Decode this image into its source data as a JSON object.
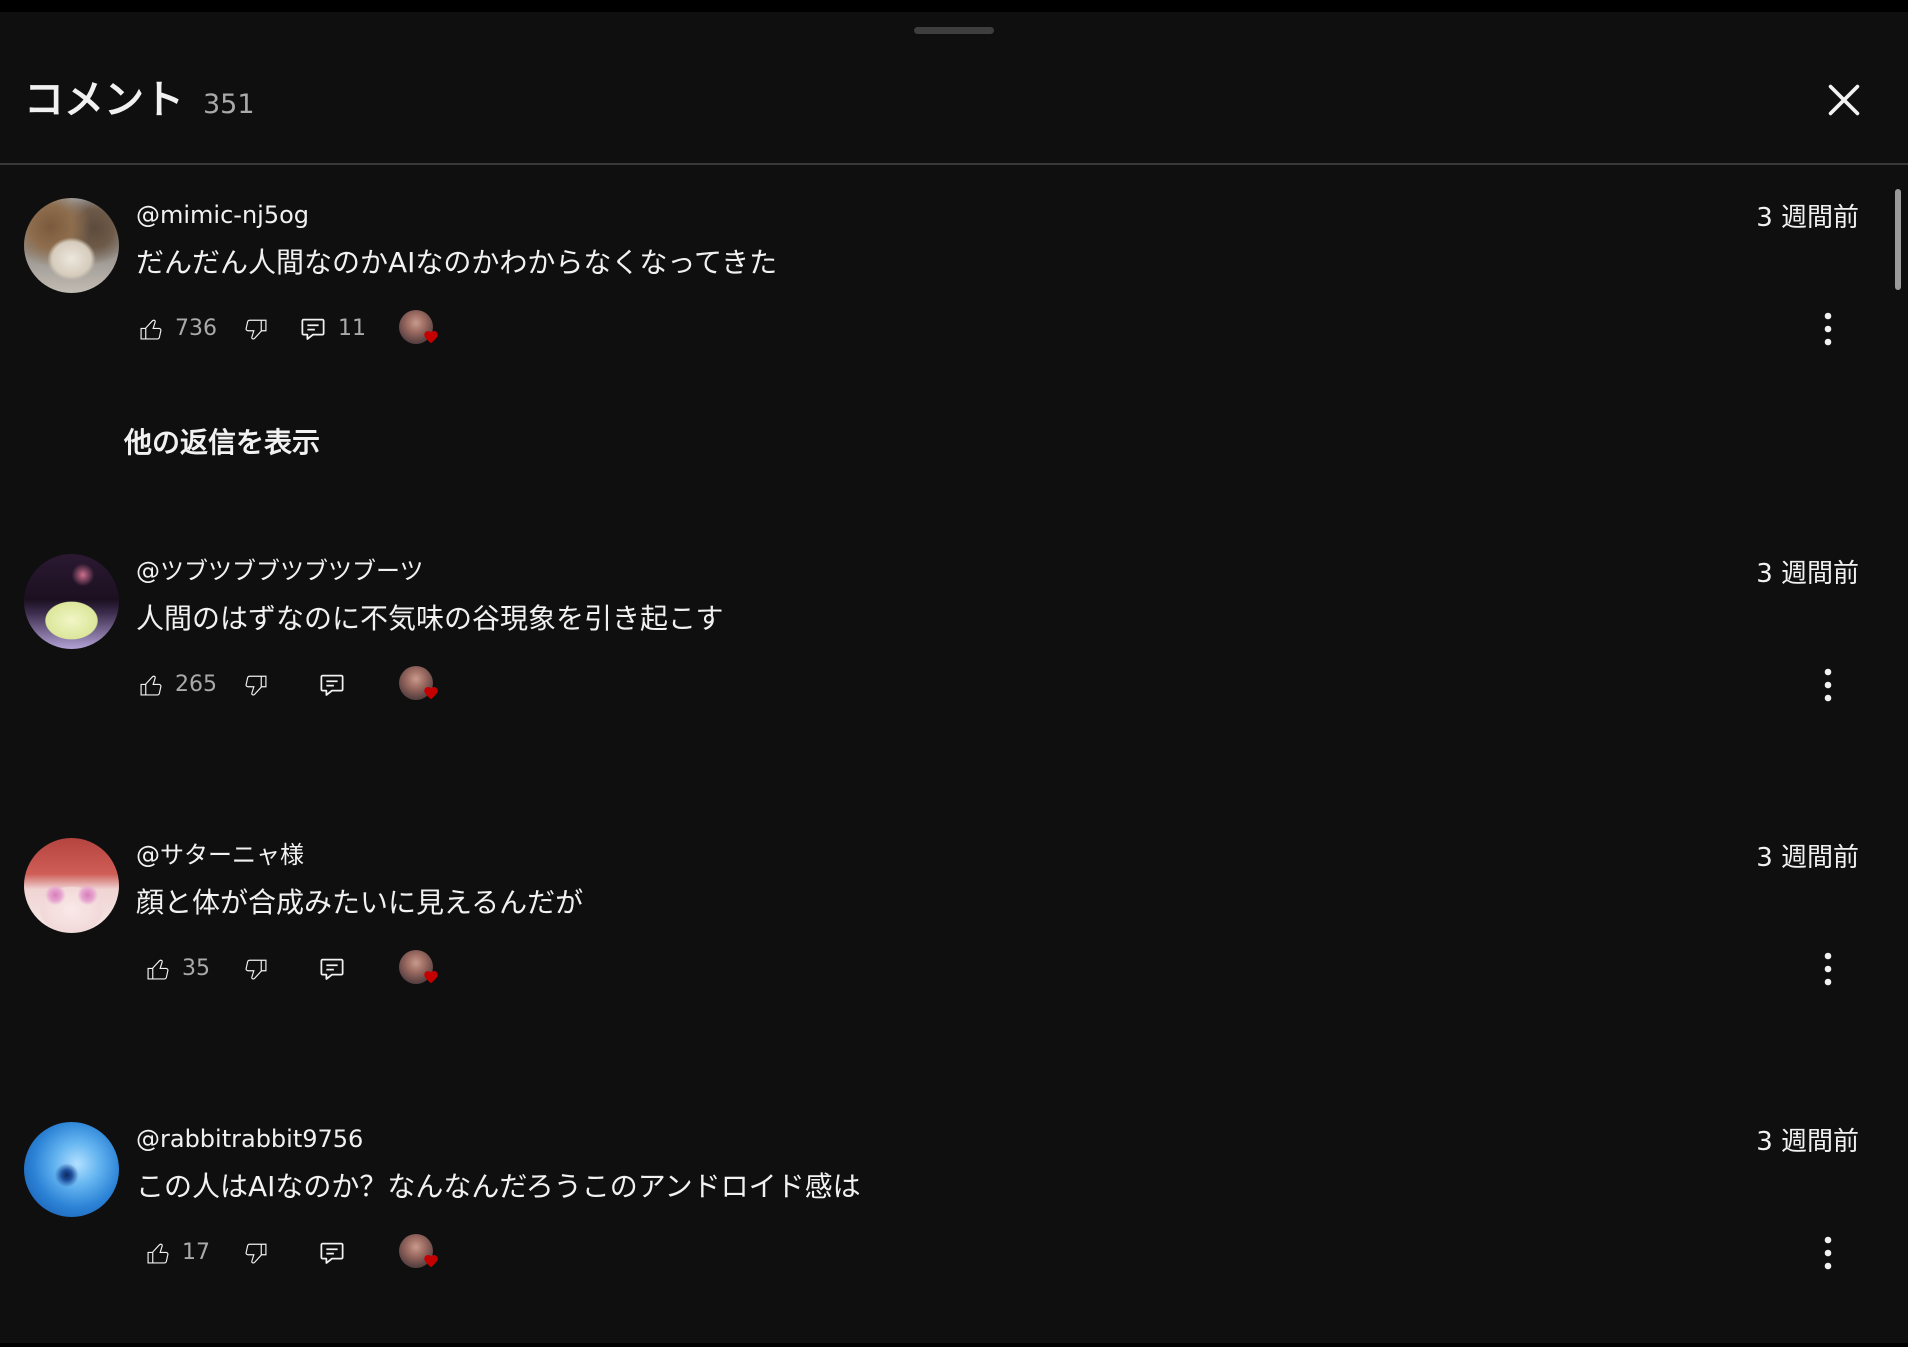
{
  "panel": {
    "title": "コメント",
    "comment_count": "351"
  },
  "comments": [
    {
      "author": "@mimic-nj5og",
      "posted": "3 週間前",
      "text": "だんだん人間なのかAIなのかわからなくなってきた",
      "likes": "736",
      "replies": "11",
      "creator_hearted": true
    },
    {
      "author": "@ツブツブブツブツブーツ",
      "posted": "3 週間前",
      "text": "人間のはずなのに不気味の谷現象を引き起こす",
      "likes": "265",
      "creator_hearted": true
    },
    {
      "author": "@サターニャ様",
      "posted": "3 週間前",
      "text": "顔と体が合成みたいに見えるんだが",
      "likes": "35",
      "creator_hearted": true
    },
    {
      "author": "@rabbitrabbit9756",
      "posted": "3 週間前",
      "text": "この人はAIなのか？なんなんだろうこのアンドロイド感は",
      "likes": "17",
      "creator_hearted": true
    }
  ],
  "show_more_replies": "他の返信を表示",
  "icons": {
    "close": "close-icon",
    "like": "thumb-up-icon",
    "dislike": "thumb-down-icon",
    "reply": "comment-icon",
    "creator_heart": "heart-icon",
    "more": "more-vert-icon"
  },
  "colors": {
    "background": "#0f0f0f",
    "text": "#f1f1f1",
    "secondary_text": "#aaaaaa",
    "heart": "#c40000"
  }
}
